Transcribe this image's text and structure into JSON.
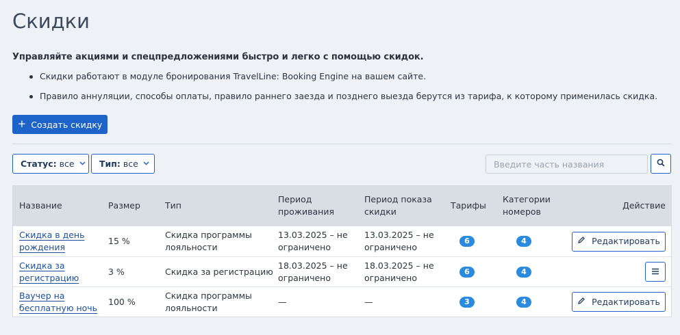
{
  "page": {
    "title": "Скидки",
    "lead": "Управляйте акциями и спецпредложениями быстро и легко с помощью скидок.",
    "bullets": [
      "Скидки работают в модуле бронирования TravelLine: Booking Engine на вашем сайте.",
      "Правило аннуляции, способы оплаты, правило раннего заезда и позднего выезда берутся из тарифа, к которому применилась скидка."
    ],
    "create_button": "Создать скидку"
  },
  "filters": {
    "status_label": "Статус:",
    "status_value": "все",
    "type_label": "Тип:",
    "type_value": "все",
    "search_placeholder": "Введите часть названия",
    "search_value": ""
  },
  "table": {
    "headers": {
      "name": "Название",
      "size": "Размер",
      "type": "Тип",
      "stay_period": "Период проживания",
      "show_period": "Период показа скидки",
      "tariffs": "Тарифы",
      "room_categories": "Категории номеров",
      "action": "Действие"
    },
    "rows": [
      {
        "name": "Скидка в день рождения",
        "size": "15 %",
        "type": "Скидка программы лояльности",
        "stay_period": "13.03.2025 – не ограничено",
        "show_period": "13.03.2025 – не ограничено",
        "tariffs": "6",
        "room_categories": "4",
        "action": "Редактировать"
      },
      {
        "name": "Скидка за регистрацию",
        "size": "3 %",
        "type": "Скидка за регистрацию",
        "stay_period": "18.03.2025 – не ограничено",
        "show_period": "18.03.2025 – не ограничено",
        "tariffs": "6",
        "room_categories": "4",
        "action": ""
      },
      {
        "name": "Ваучер на бесплатную ночь",
        "size": "100 %",
        "type": "Скидка программы лояльности",
        "stay_period": "—",
        "show_period": "—",
        "tariffs": "3",
        "room_categories": "4",
        "action": "Редактировать"
      }
    ]
  },
  "colors": {
    "accent": "#1d63c9",
    "badge": "#2a8ae0",
    "header_bg": "#d9dee5",
    "page_bg": "#eef1f5"
  }
}
